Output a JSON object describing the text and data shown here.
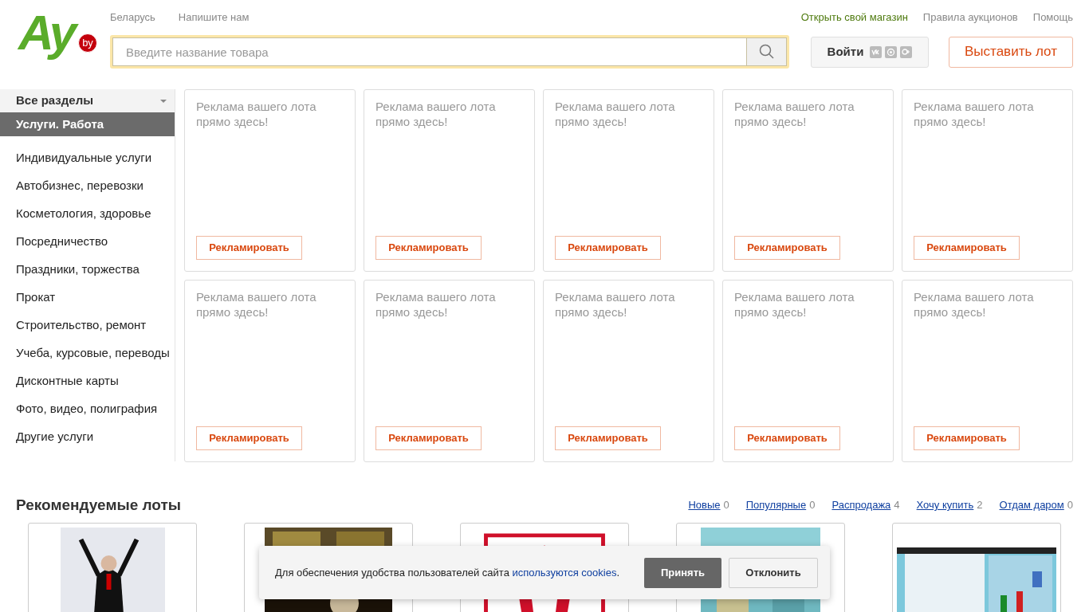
{
  "logo": {
    "main": "Ay",
    "badge": "by"
  },
  "top_links_left": [
    "Беларусь",
    "Напишите нам"
  ],
  "top_links_right": [
    {
      "label": "Открыть свой магазин",
      "kind": "accent"
    },
    {
      "label": "Правила аукционов",
      "kind": "plain"
    },
    {
      "label": "Помощь",
      "kind": "plain"
    }
  ],
  "search": {
    "placeholder": "Введите название товара"
  },
  "login_button": "Войти",
  "sell_button": "Выставить лот",
  "sidebar": {
    "header": "Все разделы",
    "current": "Услуги. Работа",
    "items": [
      "Индивидуальные услуги",
      "Автобизнес, перевозки",
      "Косметология, здоровье",
      "Посредничество",
      "Праздники, торжества",
      "Прокат",
      "Строительство, ремонт",
      "Учеба, курсовые, переводы",
      "Дисконтные карты",
      "Фото, видео, полиграфия",
      "Другие услуги"
    ]
  },
  "ads": [
    {
      "text": "Реклама вашего лота прямо здесь!",
      "button": "Рекламировать"
    },
    {
      "text": "Реклама вашего лота прямо здесь!",
      "button": "Рекламировать"
    },
    {
      "text": "Реклама вашего лота прямо здесь!",
      "button": "Рекламировать"
    },
    {
      "text": "Реклама вашего лота прямо здесь!",
      "button": "Рекламировать"
    },
    {
      "text": "Реклама вашего лота прямо здесь!",
      "button": "Рекламировать"
    },
    {
      "text": "Реклама вашего лота прямо здесь!",
      "button": "Рекламировать"
    },
    {
      "text": "Реклама вашего лота прямо здесь!",
      "button": "Рекламировать"
    },
    {
      "text": "Реклама вашего лота прямо здесь!",
      "button": "Рекламировать"
    },
    {
      "text": "Реклама вашего лота прямо здесь!",
      "button": "Рекламировать"
    },
    {
      "text": "Реклама вашего лота прямо здесь!",
      "button": "Рекламировать"
    }
  ],
  "recommended": {
    "title": "Рекомендуемые лоты",
    "filters": [
      {
        "label": "Новые",
        "count": "0"
      },
      {
        "label": "Популярные",
        "count": "0"
      },
      {
        "label": "Распродажа",
        "count": "4"
      },
      {
        "label": "Хочу купить",
        "count": "2"
      },
      {
        "label": "Отдам даром",
        "count": "0"
      }
    ]
  },
  "cookie_banner": {
    "text": "Для обеспечения удобства пользователей сайта",
    "link": "используются cookies",
    "after": ".",
    "accept": "Принять",
    "decline": "Отклонить"
  }
}
